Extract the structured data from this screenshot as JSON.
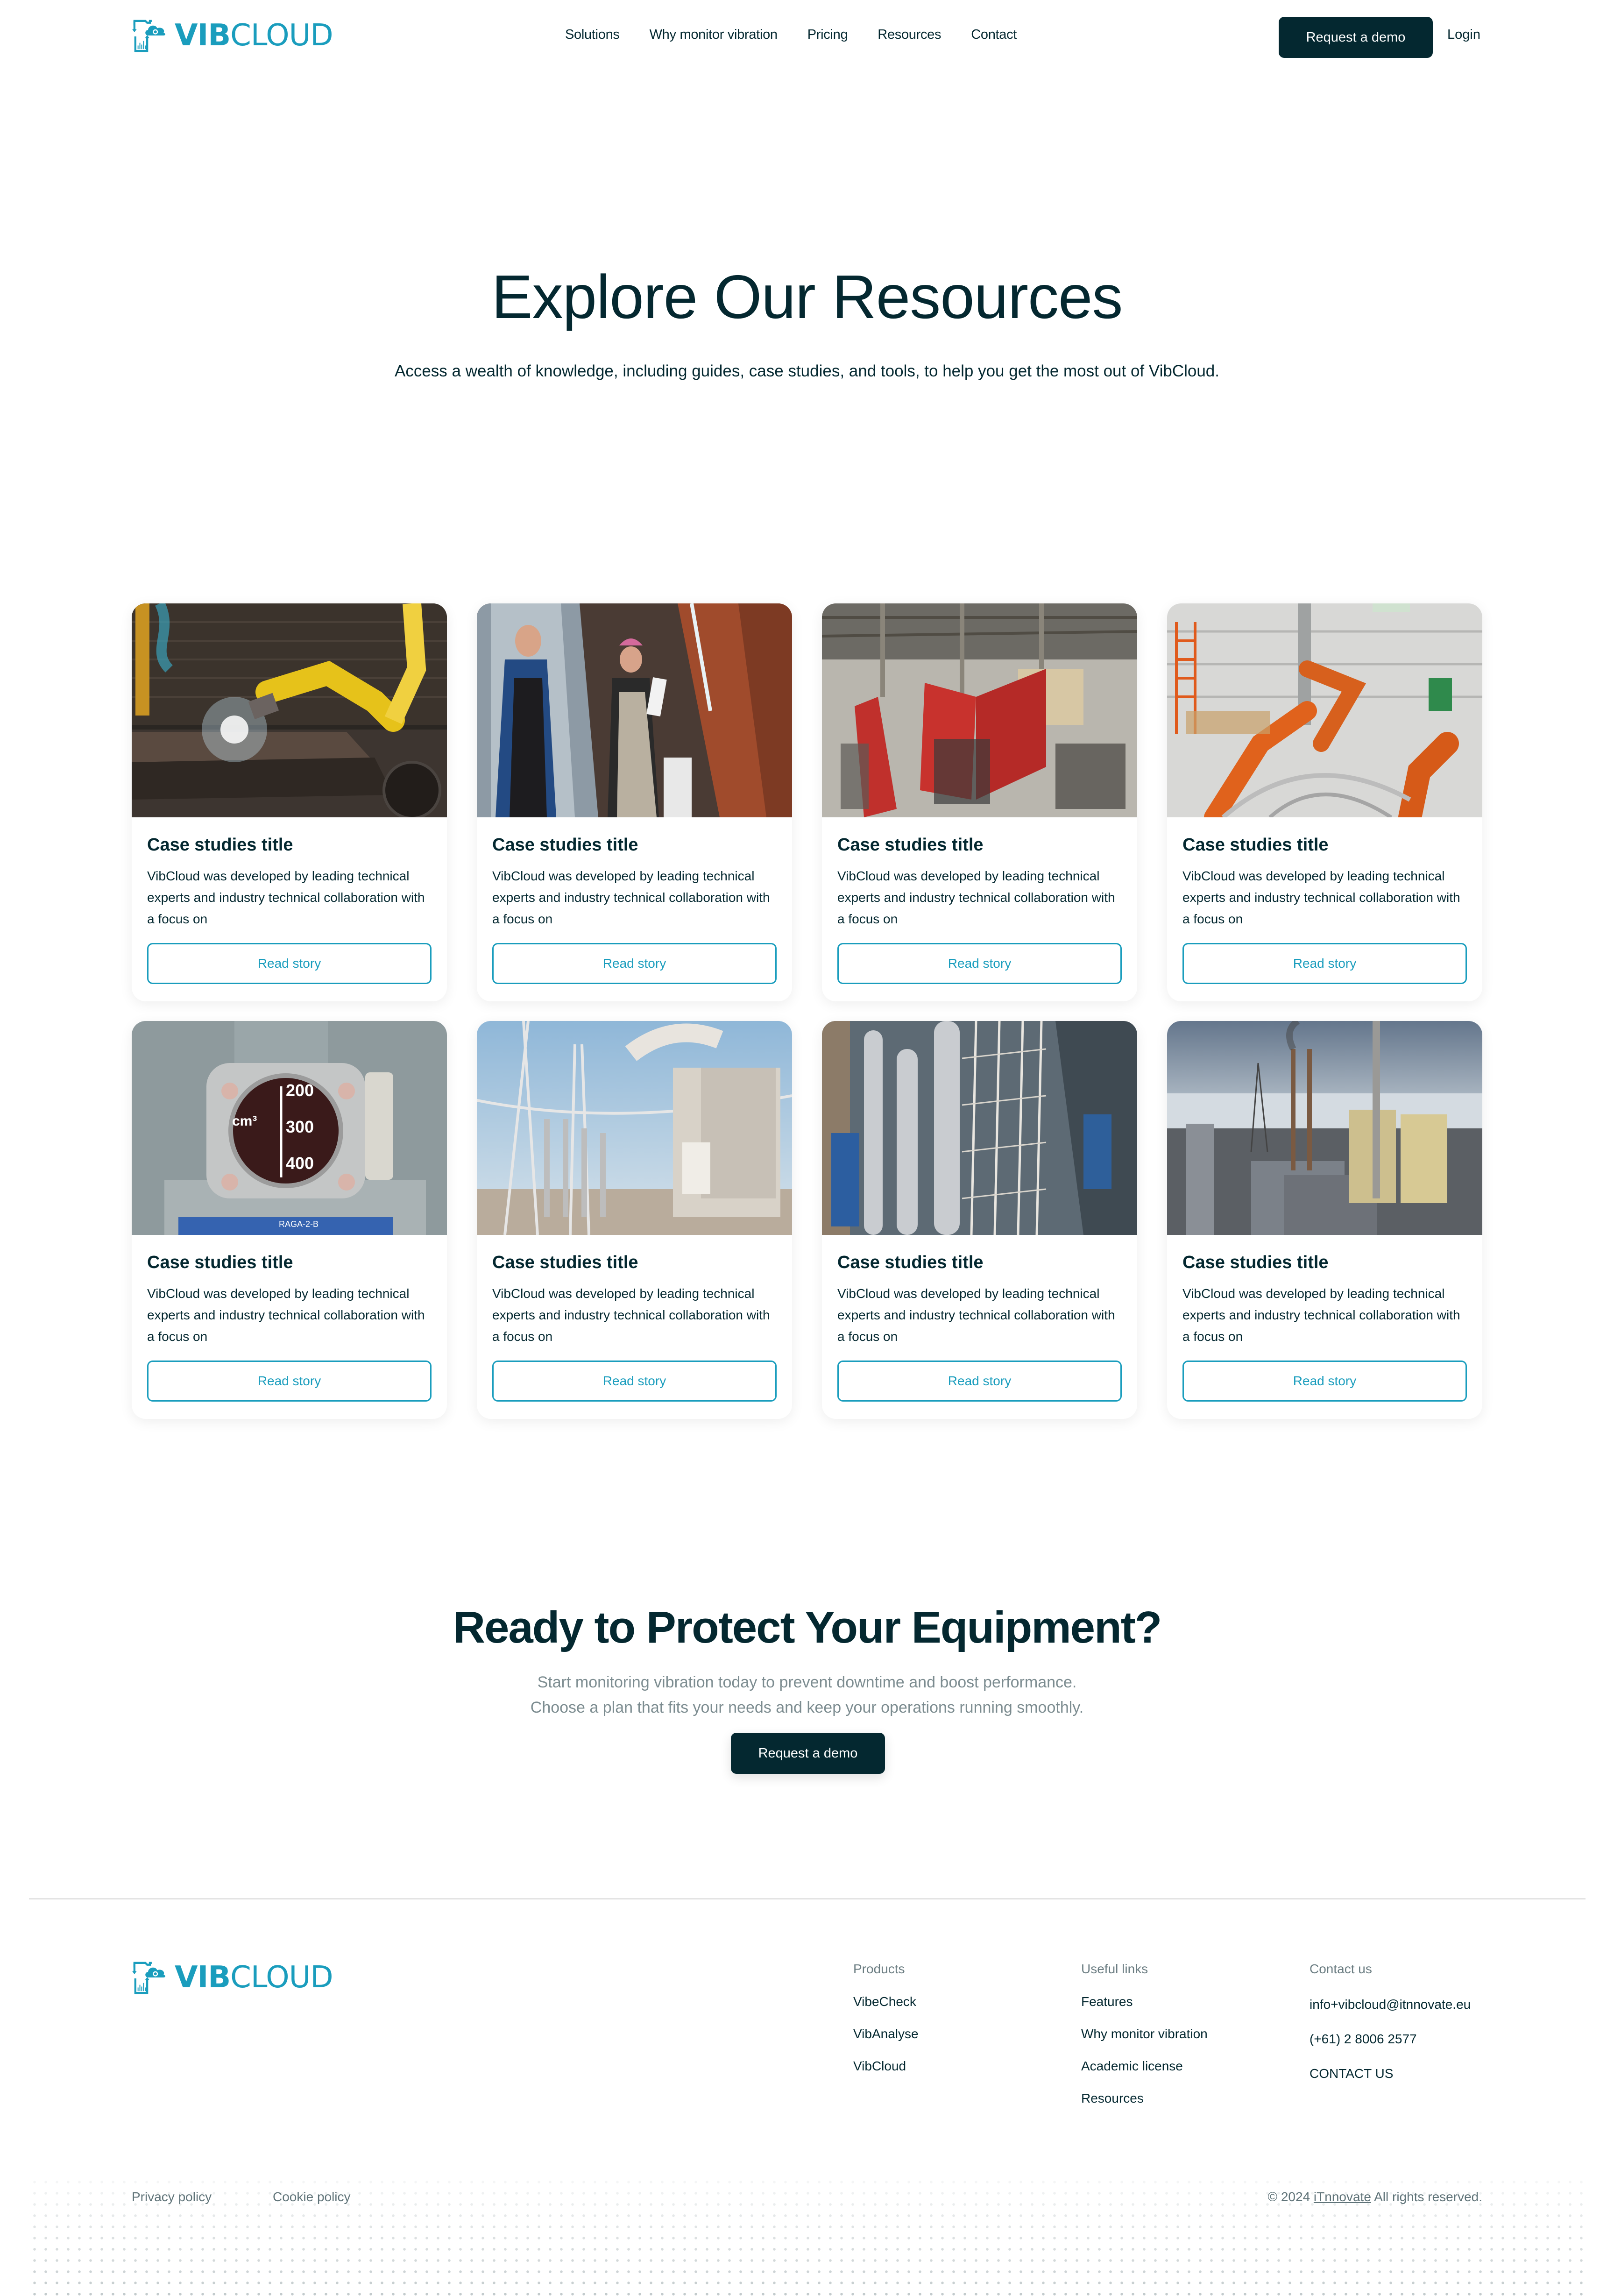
{
  "brand": {
    "name_bold": "VIB",
    "name_light": "CLOUD",
    "accent_color": "#1a9dbd",
    "dark_color": "#042830"
  },
  "header": {
    "nav": [
      "Solutions",
      "Why monitor vibration",
      "Pricing",
      "Resources",
      "Contact"
    ],
    "cta_label": "Request a demo",
    "login_label": "Login"
  },
  "hero": {
    "title": "Explore Our Resources",
    "subtitle": "Access a wealth of knowledge, including guides, case studies, and tools, to help you get the most out of VibCloud."
  },
  "cards": [
    {
      "image": "robotic-welding-arm",
      "title": "Case studies title",
      "description": "VibCloud was developed by leading technical experts and industry technical collaboration with a focus on",
      "button": "Read story"
    },
    {
      "image": "brewery-workers",
      "title": "Case studies title",
      "description": "VibCloud was developed by leading technical experts and industry technical collaboration with a focus on",
      "button": "Read story"
    },
    {
      "image": "factory-floor-red-curtains",
      "title": "Case studies title",
      "description": "VibCloud was developed by leading technical experts and industry technical collaboration with a focus on",
      "button": "Read story"
    },
    {
      "image": "automotive-robot-assembly",
      "title": "Case studies title",
      "description": "VibCloud was developed by leading technical experts and industry technical collaboration with a focus on",
      "button": "Read story"
    },
    {
      "image": "gas-receiver-gauge",
      "title": "Case studies title",
      "description": "VibCloud was developed by leading technical experts and industry technical collaboration with a focus on",
      "button": "Read story",
      "gauge_labels": [
        "200",
        "300",
        "400",
        "cm³"
      ],
      "plate_text": "RAGA-2-B"
    },
    {
      "image": "electrical-substation",
      "title": "Case studies title",
      "description": "VibCloud was developed by leading technical experts and industry technical collaboration with a focus on",
      "button": "Read story"
    },
    {
      "image": "cement-plant-pipes",
      "title": "Case studies title",
      "description": "VibCloud was developed by leading technical experts and industry technical collaboration with a focus on",
      "button": "Read story"
    },
    {
      "image": "power-plant-smokestacks",
      "title": "Case studies title",
      "description": "VibCloud was developed by leading technical experts and industry technical collaboration with a focus on",
      "button": "Read story"
    }
  ],
  "cta": {
    "title": "Ready to Protect Your Equipment?",
    "line1": "Start monitoring vibration today to prevent downtime and boost performance.",
    "line2": "Choose a plan that fits your needs and keep your operations running smoothly.",
    "button": "Request a demo"
  },
  "footer": {
    "columns": [
      {
        "heading": "Products",
        "items": [
          "VibeCheck",
          "VibAnalyse",
          "VibCloud"
        ]
      },
      {
        "heading": "Useful links",
        "items": [
          "Features",
          "Why monitor vibration",
          "Academic license",
          "Resources"
        ]
      },
      {
        "heading": "Contact us",
        "items": [
          "info+vibcloud@itnnovate.eu",
          "(+61) 2 8006 2577",
          "CONTACT US"
        ]
      }
    ],
    "privacy": "Privacy policy",
    "cookie": "Cookie policy",
    "copyright_prefix": "© 2024",
    "copyright_company": "iTnnovate",
    "copyright_suffix": "All rights reserved."
  }
}
